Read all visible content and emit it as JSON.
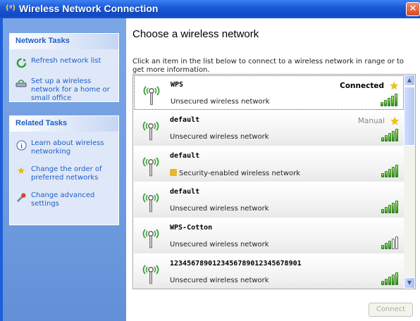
{
  "window": {
    "title": "Wireless Network Connection",
    "title_icon": "(ᵍ)",
    "close_glyph": "✕"
  },
  "sidebar": {
    "network_tasks": {
      "heading": "Network Tasks",
      "items": [
        {
          "label": "Refresh network list",
          "icon": "refresh-icon"
        },
        {
          "label": "Set up a wireless network for a home or small office",
          "icon": "setup-network-icon"
        }
      ]
    },
    "related_tasks": {
      "heading": "Related Tasks",
      "items": [
        {
          "label": "Learn about wireless networking",
          "icon": "info-icon"
        },
        {
          "label": "Change the order of preferred networks",
          "icon": "star-icon"
        },
        {
          "label": "Change advanced settings",
          "icon": "settings-icon"
        }
      ]
    }
  },
  "main": {
    "heading": "Choose a wireless network",
    "instructions": "Click an item in the list below to connect to a wireless network in range or to get more information.",
    "networks": [
      {
        "name": "WPS",
        "desc": "Unsecured wireless network",
        "status": "Connected",
        "starred": true,
        "secured": false,
        "signal_bars": 5
      },
      {
        "name": "default",
        "desc": "Unsecured wireless network",
        "status": "Manual",
        "starred": true,
        "secured": false,
        "signal_bars": 5
      },
      {
        "name": "default",
        "desc": "Security-enabled wireless network",
        "status": "",
        "starred": false,
        "secured": true,
        "signal_bars": 5
      },
      {
        "name": "default",
        "desc": "Unsecured wireless network",
        "status": "",
        "starred": false,
        "secured": false,
        "signal_bars": 5
      },
      {
        "name": "WPS-Cotton",
        "desc": "Unsecured wireless network",
        "status": "",
        "starred": false,
        "secured": false,
        "signal_bars": 3
      },
      {
        "name": "1234567890123456789012345678901",
        "desc": "Unsecured wireless network",
        "status": "",
        "starred": false,
        "secured": false,
        "signal_bars": 5
      }
    ],
    "connect_label": "Connect"
  },
  "colors": {
    "accent": "#215dc6",
    "titlebar": "#1b5ad8",
    "signal": "#2e8d1e"
  }
}
